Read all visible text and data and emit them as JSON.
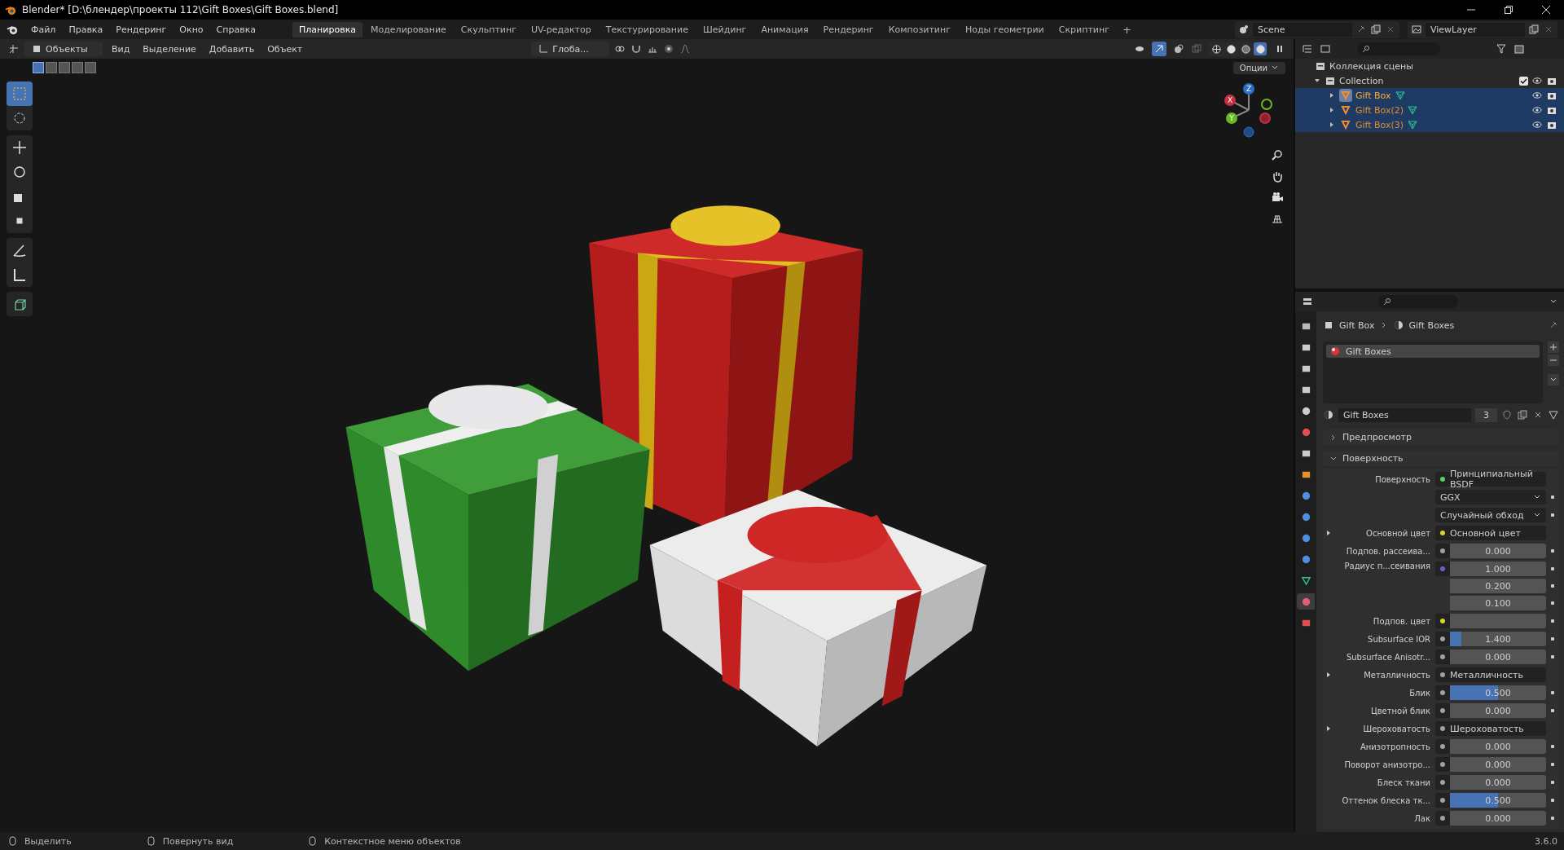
{
  "window": {
    "title": "Blender* [D:\\блендер\\проекты 112\\Gift Boxes\\Gift Boxes.blend]"
  },
  "menu": [
    "Файл",
    "Правка",
    "Рендеринг",
    "Окно",
    "Справка"
  ],
  "workspaces": [
    {
      "label": "Планировка",
      "selected": true
    },
    {
      "label": "Моделирование",
      "selected": false
    },
    {
      "label": "Скульптинг",
      "selected": false
    },
    {
      "label": "UV-редактор",
      "selected": false
    },
    {
      "label": "Текстурирование",
      "selected": false
    },
    {
      "label": "Шейдинг",
      "selected": false
    },
    {
      "label": "Анимация",
      "selected": false
    },
    {
      "label": "Рендеринг",
      "selected": false
    },
    {
      "label": "Композитинг",
      "selected": false
    },
    {
      "label": "Ноды геометрии",
      "selected": false
    },
    {
      "label": "Скриптинг",
      "selected": false
    }
  ],
  "add_workspace": "+",
  "scene": "Scene",
  "view_layer": "ViewLayer",
  "viewport": {
    "mode": "Объекты",
    "menus": [
      "Вид",
      "Выделение",
      "Добавить",
      "Объект"
    ],
    "orientation": "Глоба...",
    "options": "Опции",
    "gizmos_shown": true,
    "select_modes": [
      {
        "selected": true
      },
      {
        "selected": false
      },
      {
        "selected": false
      },
      {
        "selected": false
      },
      {
        "selected": false
      }
    ],
    "shading": [
      {
        "kind": "wireframe",
        "selected": false
      },
      {
        "kind": "solid",
        "selected": false
      },
      {
        "kind": "material",
        "selected": false
      },
      {
        "kind": "rendered",
        "selected": true
      }
    ],
    "tool_groups": [
      [
        {
          "kind": "select",
          "selected": true
        },
        {
          "kind": "cursor",
          "selected": false
        }
      ],
      [
        {
          "kind": "move",
          "selected": false
        },
        {
          "kind": "rotate",
          "selected": false
        },
        {
          "kind": "scale",
          "selected": false
        },
        {
          "kind": "transform",
          "selected": false
        }
      ],
      [
        {
          "kind": "annotate",
          "selected": false
        },
        {
          "kind": "measure",
          "selected": false
        }
      ],
      [
        {
          "kind": "add_cube",
          "selected": false
        }
      ]
    ],
    "axes": [
      "X",
      "Y",
      "Z"
    ]
  },
  "outliner": {
    "scene_collection": "Коллекция сцены",
    "collection": {
      "name": "Collection",
      "expanded": true,
      "checked": true,
      "children": [
        {
          "name": "Gift Box",
          "selected": true,
          "active": true
        },
        {
          "name": "Gift Box(2)",
          "selected": true,
          "active": false
        },
        {
          "name": "Gift Box(3)",
          "selected": true,
          "active": false
        }
      ]
    }
  },
  "properties": {
    "tabs": [
      {
        "kind": "tool",
        "selected": false
      },
      {
        "kind": "render",
        "selected": false
      },
      {
        "kind": "output",
        "selected": false
      },
      {
        "kind": "view_layer",
        "selected": false
      },
      {
        "kind": "scene",
        "selected": false
      },
      {
        "kind": "world",
        "selected": false
      },
      {
        "kind": "collection",
        "selected": false
      },
      {
        "kind": "object",
        "selected": false
      },
      {
        "kind": "modifiers",
        "selected": false
      },
      {
        "kind": "particles",
        "selected": false
      },
      {
        "kind": "physics",
        "selected": false
      },
      {
        "kind": "constraints",
        "selected": false
      },
      {
        "kind": "data",
        "selected": false
      },
      {
        "kind": "material",
        "selected": true
      },
      {
        "kind": "texture",
        "selected": false
      }
    ],
    "breadcrumb": [
      "Gift Box",
      "Gift Boxes"
    ],
    "slots": [
      {
        "name": "Gift Boxes",
        "selected": true
      }
    ],
    "material": {
      "name": "Gift Boxes",
      "users": "3"
    },
    "panels": [
      {
        "label": "Предпросмотр",
        "expanded": false
      },
      {
        "label": "Поверхность",
        "expanded": true
      }
    ],
    "rows": [
      {
        "kind": "link",
        "label": "Поверхность",
        "expandable": false,
        "color": "#5fcf5f",
        "value": "Принципиальный BSDF"
      },
      {
        "kind": "dropdown",
        "value": "GGX"
      },
      {
        "kind": "dropdown",
        "value": "Случайный обход"
      },
      {
        "kind": "link",
        "label": "Основной цвет",
        "expandable": true,
        "color": "#d6d62a",
        "value": "Основной цвет"
      },
      {
        "kind": "number",
        "label": "Подпов. рассеива...",
        "color": "#a1a1a1",
        "value": "0.000",
        "level": 0
      },
      {
        "kind": "vector",
        "label": "Радиус п...сеивания",
        "color": "#6b5fd6",
        "values": [
          "1.000",
          "0.200",
          "0.100"
        ]
      },
      {
        "kind": "swatch",
        "label": "Подпов. цвет",
        "color": "#d6d62a"
      },
      {
        "kind": "number",
        "label": "Subsurface IOR",
        "color": "#a1a1a1",
        "value": "1.400",
        "level": 0.12
      },
      {
        "kind": "number",
        "label": "Subsurface Anisotr...",
        "color": "#a1a1a1",
        "value": "0.000",
        "level": 0
      },
      {
        "kind": "link",
        "label": "Металличность",
        "expandable": true,
        "color": "#a1a1a1",
        "value": "Металличность"
      },
      {
        "kind": "number",
        "label": "Блик",
        "color": "#a1a1a1",
        "value": "0.500",
        "level": 0.5
      },
      {
        "kind": "number",
        "label": "Цветной блик",
        "color": "#a1a1a1",
        "value": "0.000",
        "level": 0
      },
      {
        "kind": "link",
        "label": "Шероховатость",
        "expandable": true,
        "color": "#a1a1a1",
        "value": "Шероховатость"
      },
      {
        "kind": "number",
        "label": "Анизотропность",
        "color": "#a1a1a1",
        "value": "0.000",
        "level": 0
      },
      {
        "kind": "number",
        "label": "Поворот анизотро...",
        "color": "#a1a1a1",
        "value": "0.000",
        "level": 0
      },
      {
        "kind": "number",
        "label": "Блеск ткани",
        "color": "#a1a1a1",
        "value": "0.000",
        "level": 0
      },
      {
        "kind": "number",
        "label": "Оттенок блеска тк...",
        "color": "#a1a1a1",
        "value": "0.500",
        "level": 0.5
      },
      {
        "kind": "number",
        "label": "Лак",
        "color": "#a1a1a1",
        "value": "0.000",
        "level": 0
      }
    ]
  },
  "status_bar": {
    "hints": [
      "Выделить",
      "Повернуть вид",
      "Контекстное меню объектов"
    ],
    "version": "3.6.0"
  }
}
